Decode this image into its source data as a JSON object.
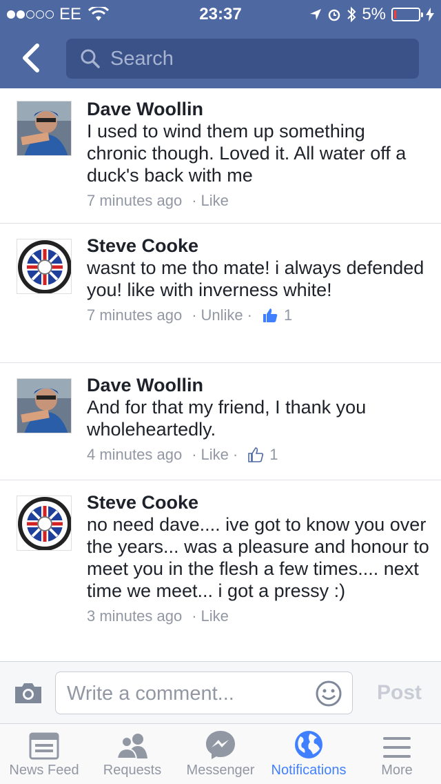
{
  "status": {
    "carrier": "EE",
    "time": "23:37",
    "battery": "5%"
  },
  "search": {
    "placeholder": "Search"
  },
  "comments": [
    {
      "name": "Dave Woollin",
      "text": "I used to wind them up something chronic though. Loved it. All water off a duck's back with me",
      "time": "7 minutes ago",
      "action": "Like",
      "likes": ""
    },
    {
      "name": "Steve Cooke",
      "text": "wasnt to me tho mate! i always defended you!   like with inverness white!",
      "time": "7 minutes ago",
      "action": "Unlike",
      "likes": "1"
    },
    {
      "name": "Dave Woollin",
      "text": "And for that my friend, I thank you wholeheartedly.",
      "time": "4 minutes ago",
      "action": "Like",
      "likes": "1"
    },
    {
      "name": "Steve Cooke",
      "text": "no need dave....  ive got to know you over the years...  was a pleasure and honour to meet you in the flesh a few times.... next time we meet... i got a pressy :)",
      "time": "3 minutes ago",
      "action": "Like",
      "likes": ""
    }
  ],
  "composer": {
    "placeholder": "Write a comment...",
    "post_label": "Post"
  },
  "tabs": [
    {
      "label": "News Feed",
      "icon": "news-feed-icon"
    },
    {
      "label": "Requests",
      "icon": "friend-requests-icon"
    },
    {
      "label": "Messenger",
      "icon": "messenger-icon"
    },
    {
      "label": "Notifications",
      "icon": "globe-icon",
      "active": true
    },
    {
      "label": "More",
      "icon": "menu-icon"
    }
  ],
  "colors": {
    "brand": "#4e69a2",
    "active_tab": "#4080ff"
  }
}
